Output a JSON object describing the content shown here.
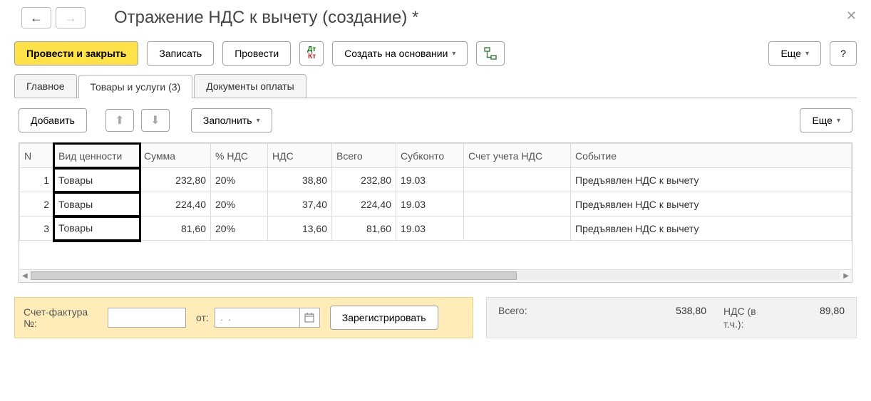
{
  "header": {
    "title": "Отражение НДС к вычету (создание) *"
  },
  "toolbar": {
    "post_close": "Провести и закрыть",
    "save": "Записать",
    "post": "Провести",
    "create_based": "Создать на основании",
    "more": "Еще",
    "help": "?"
  },
  "tabs": [
    {
      "label": "Главное"
    },
    {
      "label": "Товары и услуги (3)"
    },
    {
      "label": "Документы оплаты"
    }
  ],
  "subtoolbar": {
    "add": "Добавить",
    "fill": "Заполнить",
    "more": "Еще"
  },
  "table": {
    "headers": {
      "n": "N",
      "kind": "Вид ценности",
      "sum": "Сумма",
      "vat_pct": "% НДС",
      "vat": "НДС",
      "total": "Всего",
      "subk": "Субконто",
      "vat_acct": "Счет учета НДС",
      "event": "Событие"
    },
    "rows": [
      {
        "n": "1",
        "kind": "Товары",
        "sum": "232,80",
        "vat_pct": "20%",
        "vat": "38,80",
        "total": "232,80",
        "subk": "19.03",
        "vat_acct": "",
        "event": "Предъявлен НДС к вычету"
      },
      {
        "n": "2",
        "kind": "Товары",
        "sum": "224,40",
        "vat_pct": "20%",
        "vat": "37,40",
        "total": "224,40",
        "subk": "19.03",
        "vat_acct": "",
        "event": "Предъявлен НДС к вычету"
      },
      {
        "n": "3",
        "kind": "Товары",
        "sum": "81,60",
        "vat_pct": "20%",
        "vat": "13,60",
        "total": "81,60",
        "subk": "19.03",
        "vat_acct": "",
        "event": "Предъявлен НДС к вычету"
      }
    ]
  },
  "footer": {
    "invoice_label": "Счет-фактура №:",
    "from_label": "от:",
    "date_placeholder": " .  .    ",
    "register": "Зарегистрировать",
    "total_label": "Всего:",
    "total_value": "538,80",
    "vat_label": "НДС (в т.ч.):",
    "vat_value": "89,80"
  }
}
